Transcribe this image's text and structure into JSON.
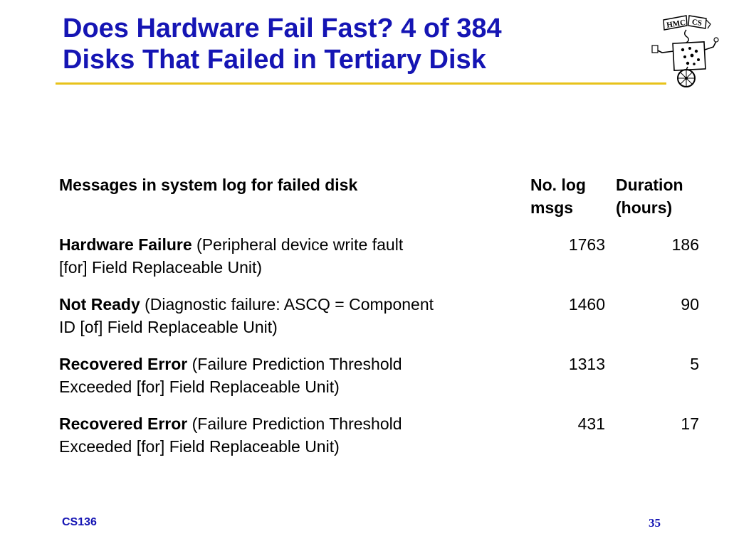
{
  "slide": {
    "title_line1": "Does Hardware Fail Fast? 4 of 384",
    "title_line2": "Disks That Failed in Tertiary Disk",
    "logo_text_left": "HMC",
    "logo_text_right": "CS",
    "footer_course": "CS136",
    "page_number": "35",
    "colors": {
      "title": "#1515b4",
      "rule": "#e8c21a",
      "text": "#000000"
    }
  },
  "table": {
    "headers": {
      "message": "Messages in system log for failed disk",
      "num_line1": "No. log",
      "num_line2": "msgs",
      "dur_line1": "Duration",
      "dur_line2": "(hours)"
    },
    "rows": [
      {
        "bold": "Hardware Failure",
        "line1_rest": " (Peripheral device write fault",
        "line2": "[for] Field Replaceable Unit)",
        "num_msgs": "1763",
        "duration": "186"
      },
      {
        "bold": "Not Ready",
        "line1_rest": " (Diagnostic failure: ASCQ = Component",
        "line2": "ID [of] Field Replaceable Unit)",
        "num_msgs": "1460",
        "duration": "90"
      },
      {
        "bold": "Recovered Error",
        "line1_rest": " (Failure Prediction Threshold",
        "line2": "Exceeded [for] Field Replaceable Unit)",
        "num_msgs": "1313",
        "duration": "5"
      },
      {
        "bold": "Recovered Error",
        "line1_rest": " (Failure Prediction Threshold",
        "line2": "Exceeded [for] Field Replaceable Unit)",
        "num_msgs": "431",
        "duration": "17"
      }
    ]
  }
}
